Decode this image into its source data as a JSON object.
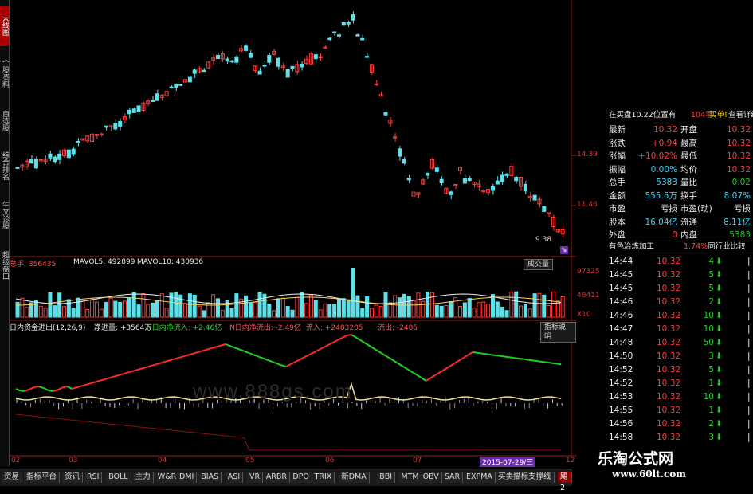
{
  "sidebar": {
    "tabs": [
      {
        "label": "K线图",
        "active": true
      },
      {
        "label": "个股资料",
        "active": false
      },
      {
        "label": "自选股",
        "active": false
      },
      {
        "label": "综合排名",
        "active": false
      },
      {
        "label": "牛叉诊股",
        "active": false
      },
      {
        "label": "超级盘口",
        "active": false
      }
    ]
  },
  "kline": {
    "price_labels": [
      "14.39",
      "11.46",
      "9.38"
    ],
    "arrow_mark": "⇘"
  },
  "volume": {
    "header": {
      "total_label": "总手: 356435",
      "ma5_label": "MAVOL5: 492899",
      "ma10_label": "MAVOL10: 430936"
    },
    "button": "成交量",
    "axis_labels": [
      "97325",
      "48411",
      "X10"
    ]
  },
  "fund": {
    "header": {
      "title": "日内资金进出(12,26,9)",
      "net_in": "净进量: +3564万",
      "n_net_in": "N日内净流入: +2.46亿",
      "n_net_out": "N日内净流出: -2.49亿",
      "inflow": "流入: +2483205",
      "outflow": "流出: -2485"
    },
    "button": "指标说明",
    "watermark": "www.888gs.com"
  },
  "xaxis": {
    "labels": [
      "02",
      "03",
      "04",
      "05",
      "06",
      "07",
      "12"
    ],
    "date_highlight": "2015-07-29/三"
  },
  "bottom_tabs": [
    {
      "label": "资易",
      "active": false
    },
    {
      "label": "指标平台",
      "active": false
    },
    {
      "label": "资讯",
      "active": false
    },
    {
      "label": "RSI",
      "active": false
    },
    {
      "label": "BOLL",
      "active": false
    },
    {
      "label": "主力",
      "active": false
    },
    {
      "label": "W&R",
      "active": false
    },
    {
      "label": "DMI",
      "active": false
    },
    {
      "label": "BIAS",
      "active": false
    },
    {
      "label": "ASI",
      "active": false
    },
    {
      "label": "VR",
      "active": false
    },
    {
      "label": "ARBR",
      "active": false
    },
    {
      "label": "DPO",
      "active": false
    },
    {
      "label": "TRIX",
      "active": false
    },
    {
      "label": "新DMA",
      "active": false
    },
    {
      "label": "BBI",
      "active": false
    },
    {
      "label": "MTM",
      "active": false
    },
    {
      "label": "OBV",
      "active": false
    },
    {
      "label": "SAR",
      "active": false
    },
    {
      "label": "EXPMA",
      "active": false
    },
    {
      "label": "买卖描标支撑线",
      "active": false
    },
    {
      "label": "飓2",
      "active": true
    }
  ],
  "quote": {
    "order_line": {
      "text": "在买盘10.22位置有",
      "qty": "104手",
      "buy": "买单!",
      "detail": "查看详细"
    },
    "rows": [
      {
        "l1": "最新",
        "v1": "10.32",
        "l2": "开盘",
        "v2": "10.32",
        "c1": "red",
        "c2": "red"
      },
      {
        "l1": "涨跌",
        "v1": "+0.94",
        "l2": "最高",
        "v2": "10.32",
        "c1": "red",
        "c2": "red"
      },
      {
        "l1": "涨幅",
        "v1": "+10.02%",
        "l2": "最低",
        "v2": "10.32",
        "c1": "red",
        "c2": "red"
      },
      {
        "l1": "振幅",
        "v1": "0.00%",
        "l2": "均价",
        "v2": "10.32",
        "c1": "cyan",
        "c2": "red"
      },
      {
        "l1": "总手",
        "v1": "5383",
        "l2": "量比",
        "v2": "0.02",
        "c1": "cyan",
        "c2": "green"
      },
      {
        "l1": "金额",
        "v1": "555.5万",
        "l2": "换手",
        "v2": "8.07%",
        "c1": "cyan",
        "c2": "cyan"
      },
      {
        "l1": "市盈",
        "v1": "亏损",
        "l2": "市盈(动)",
        "v2": "亏损",
        "c1": "white",
        "c2": "white"
      },
      {
        "l1": "股本",
        "v1": "16.04亿",
        "l2": "流通",
        "v2": "8.11亿",
        "c1": "cyan",
        "c2": "cyan"
      },
      {
        "l1": "外盘",
        "v1": "0",
        "l2": "内盘",
        "v2": "5383",
        "c1": "red",
        "c2": "green"
      }
    ],
    "industry": {
      "name": "有色冶炼加工",
      "pct": "1.74%",
      "compare": "同行业比较"
    },
    "ticks": [
      {
        "time": "14:44",
        "price": "10.32",
        "vol": "4"
      },
      {
        "time": "14:45",
        "price": "10.32",
        "vol": "5"
      },
      {
        "time": "14:45",
        "price": "10.32",
        "vol": "5"
      },
      {
        "time": "14:46",
        "price": "10.32",
        "vol": "2"
      },
      {
        "time": "14:46",
        "price": "10.32",
        "vol": "10"
      },
      {
        "time": "14:47",
        "price": "10.32",
        "vol": "10"
      },
      {
        "time": "14:48",
        "price": "10.32",
        "vol": "50"
      },
      {
        "time": "14:50",
        "price": "10.32",
        "vol": "3"
      },
      {
        "time": "14:52",
        "price": "10.32",
        "vol": "5"
      },
      {
        "time": "14:52",
        "price": "10.32",
        "vol": "1"
      },
      {
        "time": "14:53",
        "price": "10.32",
        "vol": "10"
      },
      {
        "time": "14:55",
        "price": "10.32",
        "vol": "1"
      },
      {
        "time": "14:56",
        "price": "10.32",
        "vol": "2"
      },
      {
        "time": "14:58",
        "price": "10.32",
        "vol": "3"
      }
    ]
  },
  "watermark": {
    "line1": "乐淘公式网",
    "line2": "www.60lt.com"
  },
  "colors": {
    "up": "#ff3b3b",
    "down": "#5ee0e8",
    "bg": "#000000",
    "green_line": "#20c020",
    "yellow_line": "#f0e090"
  }
}
